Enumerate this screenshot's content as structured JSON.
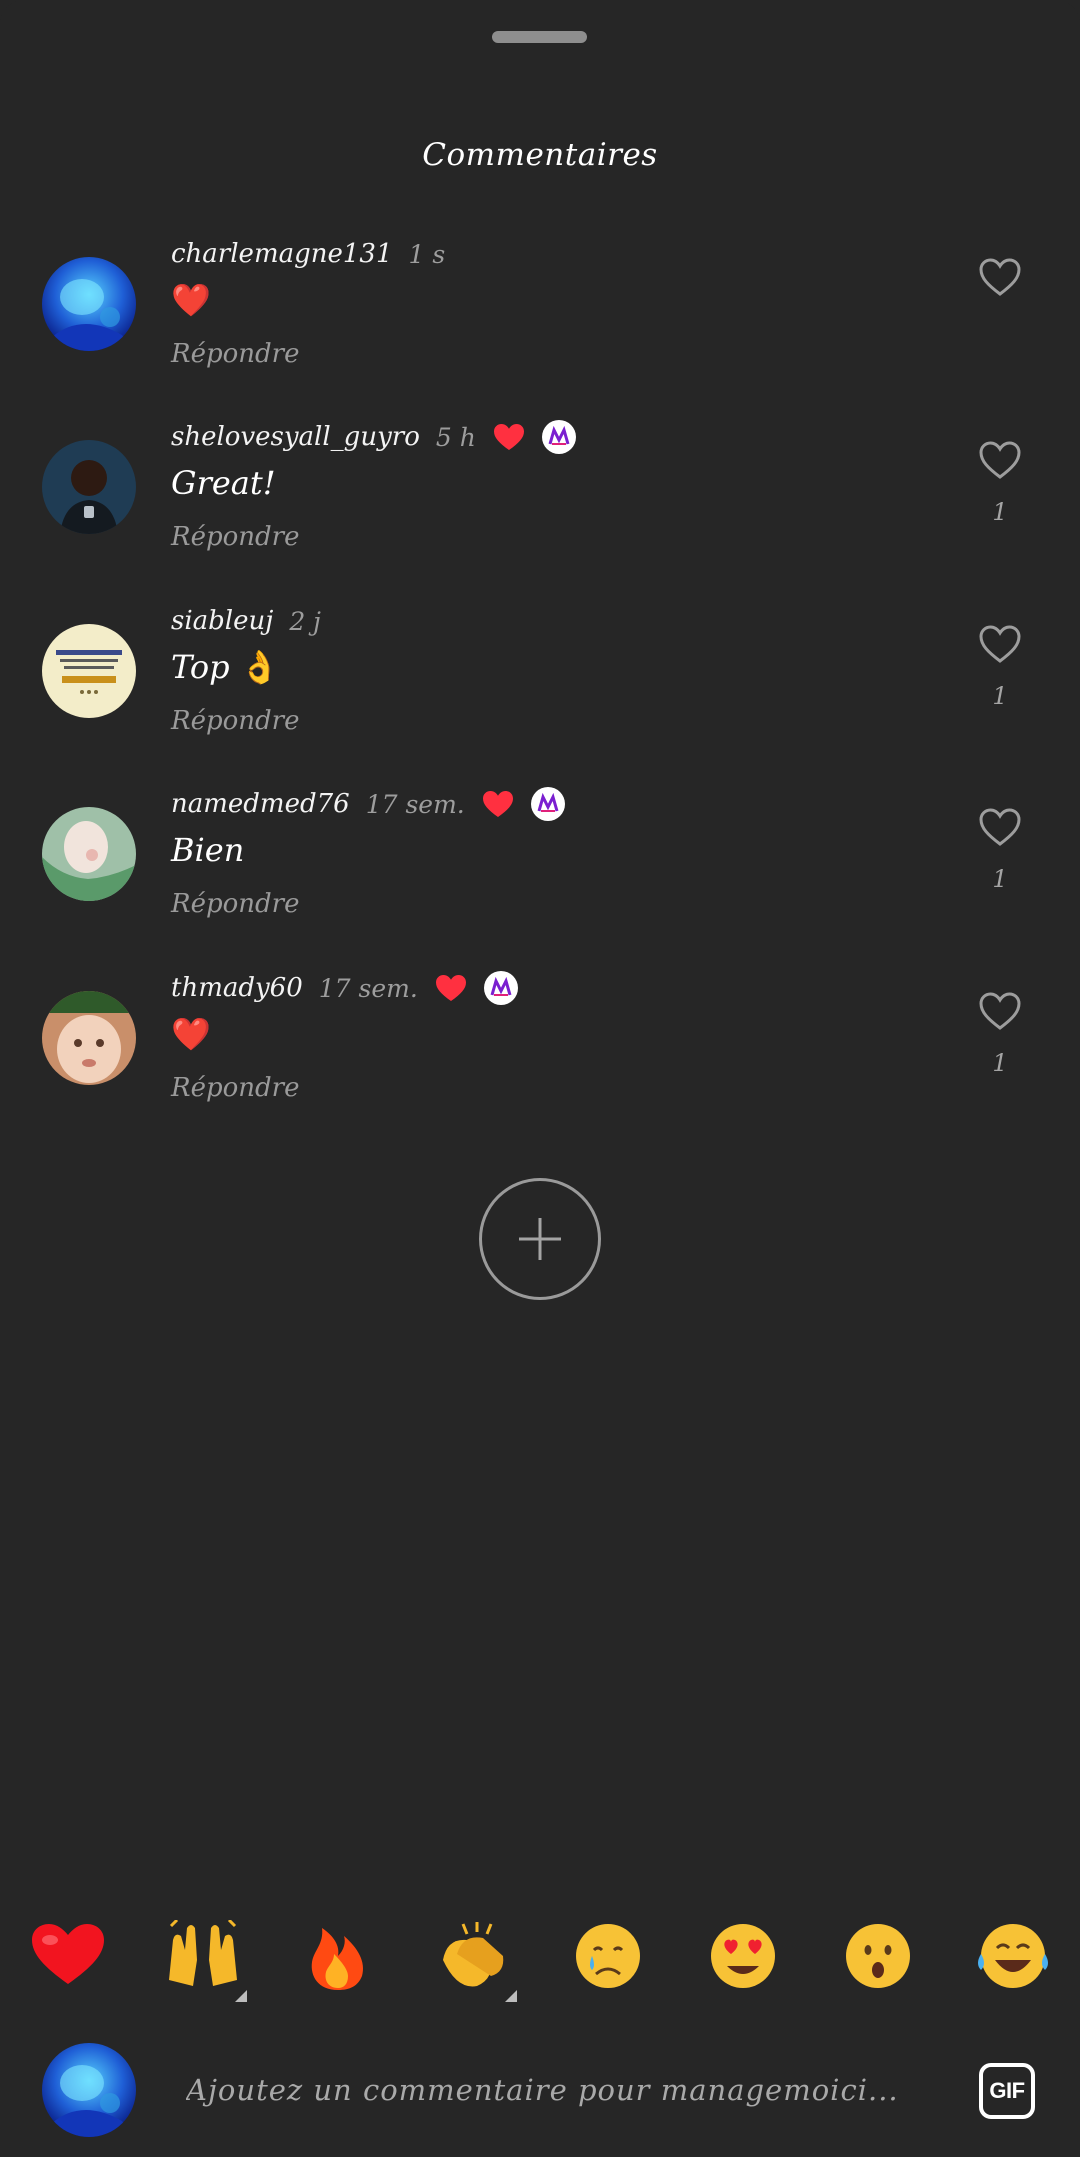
{
  "sheet": {
    "title": "Commentaires"
  },
  "comments": [
    {
      "username": "charlemagne131",
      "time": "1 s",
      "text": "",
      "emoji": "❤️",
      "reply": "Répondre",
      "like_count": "",
      "author_liked": false
    },
    {
      "username": "shelovesyall_guyro",
      "time": "5 h",
      "text": "Great!",
      "emoji": "",
      "reply": "Répondre",
      "like_count": "1",
      "author_liked": true
    },
    {
      "username": "siableuj",
      "time": "2 j",
      "text": "Top",
      "emoji": "👌",
      "reply": "Répondre",
      "like_count": "1",
      "author_liked": false
    },
    {
      "username": "namedmed76",
      "time": "17 sem.",
      "text": "Bien",
      "emoji": "",
      "reply": "Répondre",
      "like_count": "1",
      "author_liked": true
    },
    {
      "username": "thmady60",
      "time": "17 sem.",
      "text": "",
      "emoji": "❤️",
      "reply": "Répondre",
      "like_count": "1",
      "author_liked": true
    }
  ],
  "quick_reactions": [
    {
      "name": "red-heart",
      "glyph": "❤️"
    },
    {
      "name": "raising-hands",
      "glyph": "🙌"
    },
    {
      "name": "fire",
      "glyph": "🔥"
    },
    {
      "name": "clapping-hands",
      "glyph": "👏"
    },
    {
      "name": "crying-face",
      "glyph": "😢"
    },
    {
      "name": "heart-eyes",
      "glyph": "😍"
    },
    {
      "name": "surprised-face",
      "glyph": "😮"
    },
    {
      "name": "tears-of-joy",
      "glyph": "😂"
    }
  ],
  "composer": {
    "placeholder": "Ajoutez un commentaire pour managemoici...",
    "gif_label": "GIF"
  },
  "colors": {
    "background": "#262626",
    "like_red": "#ff3040",
    "muted_text": "#9a9a9a"
  },
  "icons": {
    "liked_badge": "red-heart-icon",
    "like": "heart-outline-icon",
    "add": "plus-icon"
  }
}
